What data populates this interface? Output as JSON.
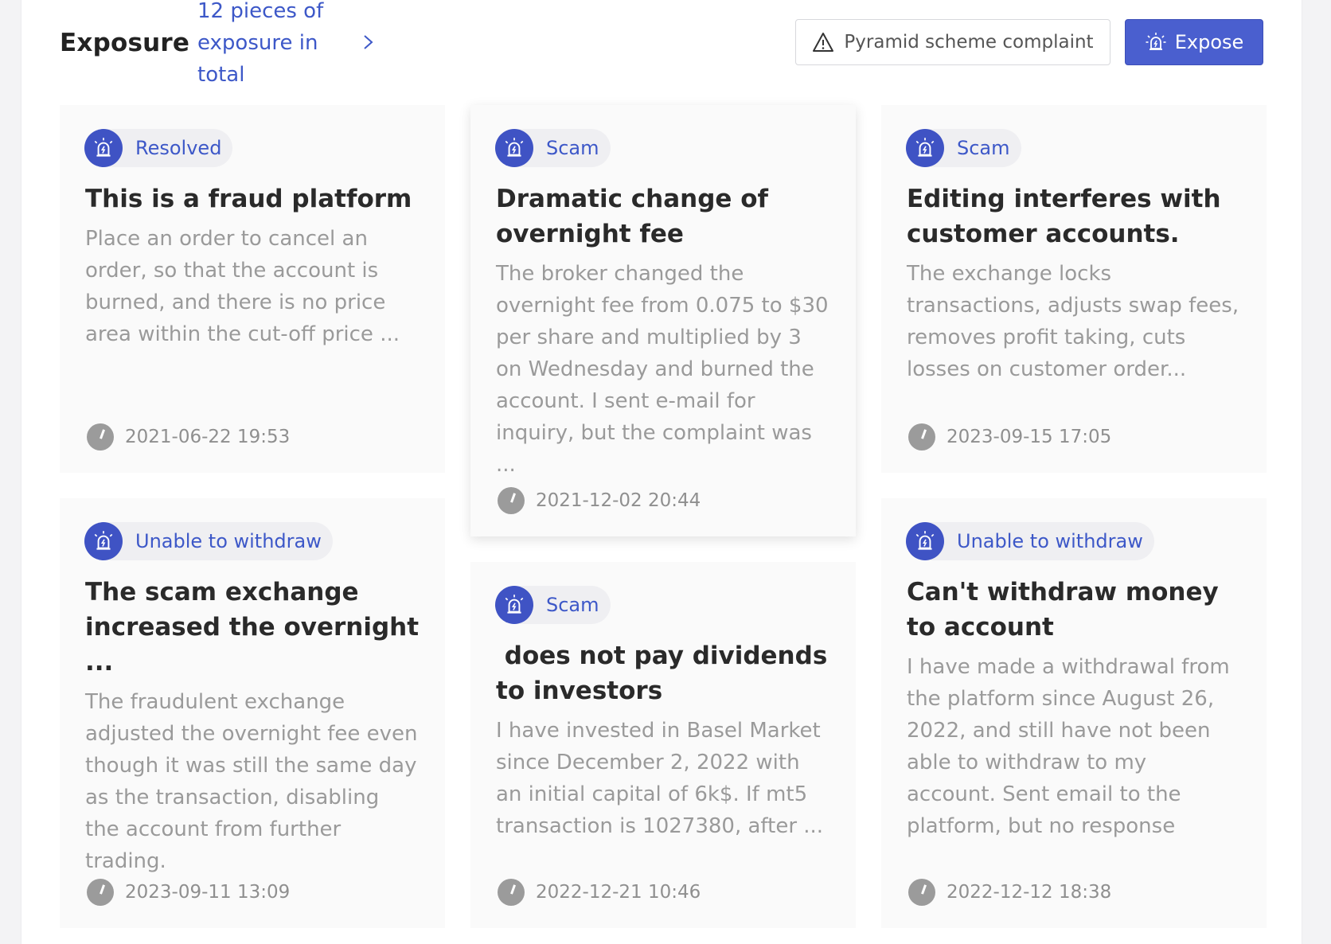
{
  "header": {
    "title": "Exposure",
    "count_link": "12 pieces of exposure in total",
    "complaint_button": "Pyramid scheme complaint",
    "expose_button": "Expose"
  },
  "cards": [
    {
      "tag": "Resolved",
      "title": "This is a fraud platform",
      "desc": "Place an order to cancel an order, so that the account is burned, and there is no price area within the cut-off price ...",
      "time": "2021-06-22 19:53"
    },
    {
      "tag": "Scam",
      "title": "Dramatic change of overnight fee",
      "desc": "The broker changed the overnight fee from 0.075 to $30 per share and multiplied by 3 on Wednesday and burned the account. I sent e-mail for inquiry, but the complaint was ...",
      "time": "2021-12-02 20:44"
    },
    {
      "tag": "Scam",
      "title": "Editing interferes with customer accounts.",
      "desc": "The exchange locks transactions, adjusts swap fees, removes profit taking, cuts losses on customer order...",
      "time": "2023-09-15 17:05"
    },
    {
      "tag": "Unable to withdraw",
      "title": "The scam exchange increased the overnight ...",
      "desc": "The fraudulent exchange adjusted the overnight fee even though it was still the same day as the transaction, disabling the account from further trading.",
      "time": "2023-09-11 13:09"
    },
    {
      "tag": "Scam",
      "title": " does not pay dividends to investors",
      "desc": "I have invested in Basel Market since December 2, 2022 with an initial capital of 6k$. If mt5 transaction is 1027380, after ...",
      "time": "2022-12-21 10:46"
    },
    {
      "tag": "Unable to withdraw",
      "title": "Can't withdraw money to account",
      "desc": "I have made a withdrawal from the platform since August 26, 2022, and still have not been able to withdraw to my account. Sent email to the platform, but no response",
      "time": "2022-12-12 18:38"
    }
  ]
}
